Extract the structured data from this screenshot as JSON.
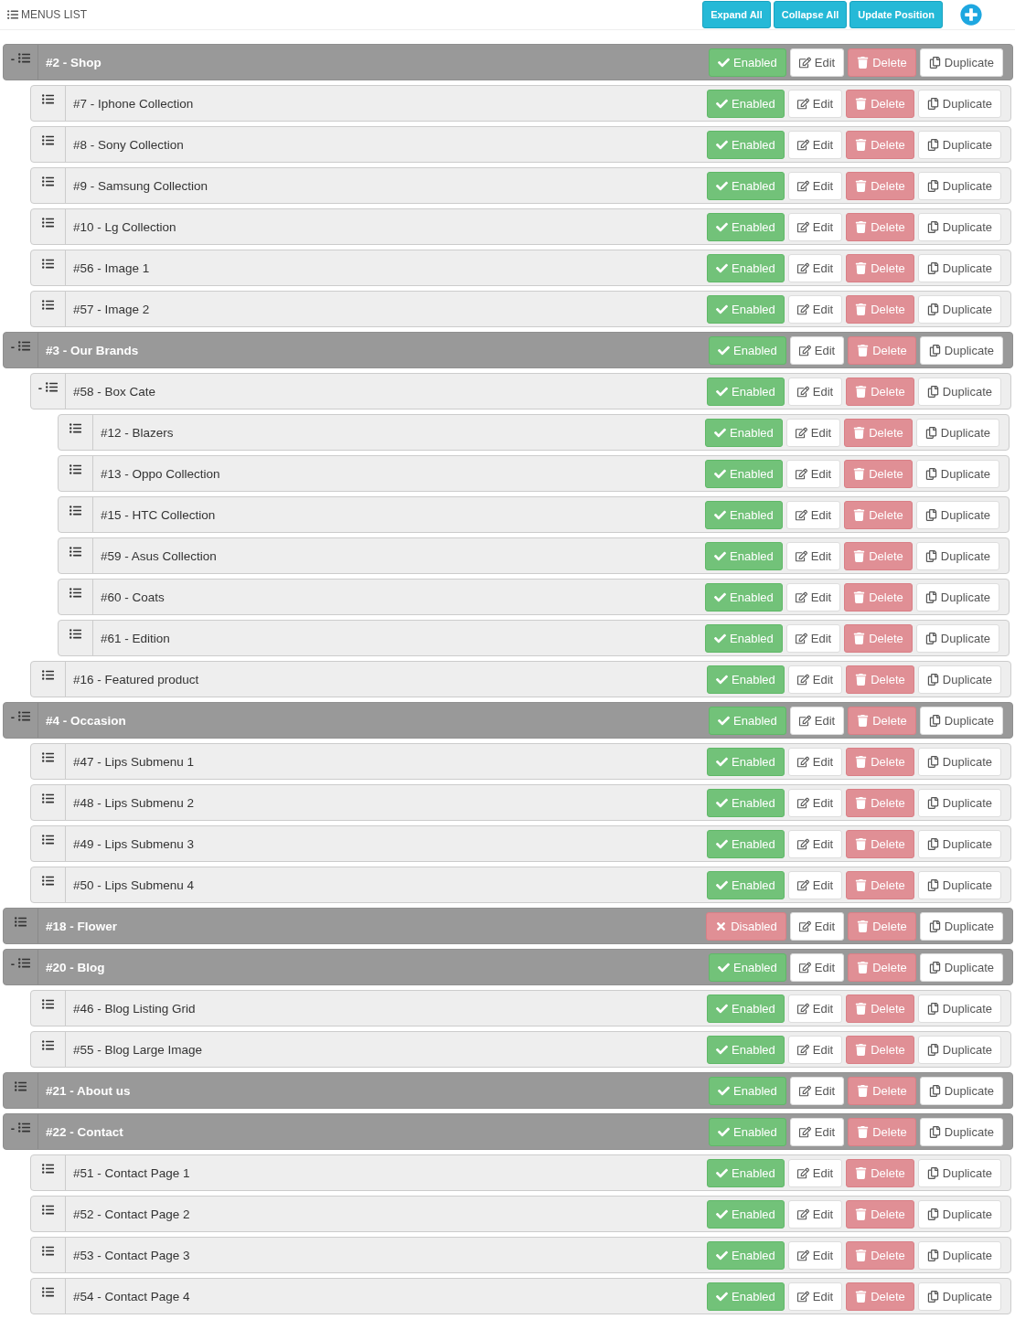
{
  "header": {
    "title": "MENUS LIST",
    "buttons": [
      "Expand All",
      "Collapse All",
      "Update Position"
    ]
  },
  "menus": [
    {
      "label": "#2 - Shop",
      "toggle": "-",
      "status": "Enabled",
      "enabled": true,
      "actions": [
        "Edit",
        "Delete",
        "Duplicate"
      ],
      "children": [
        {
          "label": "#7 - Iphone Collection",
          "status": "Enabled",
          "enabled": true,
          "actions": [
            "Edit",
            "Delete",
            "Duplicate"
          ]
        },
        {
          "label": "#8 - Sony Collection",
          "status": "Enabled",
          "enabled": true,
          "actions": [
            "Edit",
            "Delete",
            "Duplicate"
          ]
        },
        {
          "label": "#9 - Samsung Collection",
          "status": "Enabled",
          "enabled": true,
          "actions": [
            "Edit",
            "Delete",
            "Duplicate"
          ]
        },
        {
          "label": "#10 - Lg Collection",
          "status": "Enabled",
          "enabled": true,
          "actions": [
            "Edit",
            "Delete",
            "Duplicate"
          ]
        },
        {
          "label": "#56 - Image 1",
          "status": "Enabled",
          "enabled": true,
          "actions": [
            "Edit",
            "Delete",
            "Duplicate"
          ]
        },
        {
          "label": "#57 - Image 2",
          "status": "Enabled",
          "enabled": true,
          "actions": [
            "Edit",
            "Delete",
            "Duplicate"
          ]
        }
      ]
    },
    {
      "label": "#3 - Our Brands",
      "toggle": "-",
      "status": "Enabled",
      "enabled": true,
      "actions": [
        "Edit",
        "Delete",
        "Duplicate"
      ],
      "children": [
        {
          "label": "#58 - Box Cate",
          "toggle": "-",
          "status": "Enabled",
          "enabled": true,
          "actions": [
            "Edit",
            "Delete",
            "Duplicate"
          ],
          "children": [
            {
              "label": "#12 - Blazers",
              "status": "Enabled",
              "enabled": true,
              "actions": [
                "Edit",
                "Delete",
                "Duplicate"
              ]
            },
            {
              "label": "#13 - Oppo Collection",
              "status": "Enabled",
              "enabled": true,
              "actions": [
                "Edit",
                "Delete",
                "Duplicate"
              ]
            },
            {
              "label": "#15 - HTC Collection",
              "status": "Enabled",
              "enabled": true,
              "actions": [
                "Edit",
                "Delete",
                "Duplicate"
              ]
            },
            {
              "label": "#59 - Asus Collection",
              "status": "Enabled",
              "enabled": true,
              "actions": [
                "Edit",
                "Delete",
                "Duplicate"
              ]
            },
            {
              "label": "#60 - Coats",
              "status": "Enabled",
              "enabled": true,
              "actions": [
                "Edit",
                "Delete",
                "Duplicate"
              ]
            },
            {
              "label": "#61 - Edition",
              "status": "Enabled",
              "enabled": true,
              "actions": [
                "Edit",
                "Delete",
                "Duplicate"
              ]
            }
          ]
        },
        {
          "label": "#16 - Featured product",
          "status": "Enabled",
          "enabled": true,
          "actions": [
            "Edit",
            "Delete",
            "Duplicate"
          ]
        }
      ]
    },
    {
      "label": "#4 - Occasion",
      "toggle": "-",
      "status": "Enabled",
      "enabled": true,
      "actions": [
        "Edit",
        "Delete",
        "Duplicate"
      ],
      "children": [
        {
          "label": "#47 - Lips Submenu 1",
          "status": "Enabled",
          "enabled": true,
          "actions": [
            "Edit",
            "Delete",
            "Duplicate"
          ]
        },
        {
          "label": "#48 - Lips Submenu 2",
          "status": "Enabled",
          "enabled": true,
          "actions": [
            "Edit",
            "Delete",
            "Duplicate"
          ]
        },
        {
          "label": "#49 - Lips Submenu 3",
          "status": "Enabled",
          "enabled": true,
          "actions": [
            "Edit",
            "Delete",
            "Duplicate"
          ]
        },
        {
          "label": "#50 - Lips Submenu 4",
          "status": "Enabled",
          "enabled": true,
          "actions": [
            "Edit",
            "Delete",
            "Duplicate"
          ]
        }
      ]
    },
    {
      "label": "#18 - Flower",
      "status": "Disabled",
      "enabled": false,
      "actions": [
        "Edit",
        "Delete",
        "Duplicate"
      ]
    },
    {
      "label": "#20 - Blog",
      "toggle": "-",
      "status": "Enabled",
      "enabled": true,
      "actions": [
        "Edit",
        "Delete",
        "Duplicate"
      ],
      "children": [
        {
          "label": "#46 - Blog Listing Grid",
          "status": "Enabled",
          "enabled": true,
          "actions": [
            "Edit",
            "Delete",
            "Duplicate"
          ]
        },
        {
          "label": "#55 - Blog Large Image",
          "status": "Enabled",
          "enabled": true,
          "actions": [
            "Edit",
            "Delete",
            "Duplicate"
          ]
        }
      ]
    },
    {
      "label": "#21 - About us",
      "status": "Enabled",
      "enabled": true,
      "actions": [
        "Edit",
        "Delete",
        "Duplicate"
      ]
    },
    {
      "label": "#22 - Contact",
      "toggle": "-",
      "status": "Enabled",
      "enabled": true,
      "actions": [
        "Edit",
        "Delete",
        "Duplicate"
      ],
      "children": [
        {
          "label": "#51 - Contact Page 1",
          "status": "Enabled",
          "enabled": true,
          "actions": [
            "Edit",
            "Delete",
            "Duplicate"
          ]
        },
        {
          "label": "#52 - Contact Page 2",
          "status": "Enabled",
          "enabled": true,
          "actions": [
            "Edit",
            "Delete",
            "Duplicate"
          ]
        },
        {
          "label": "#53 - Contact Page 3",
          "status": "Enabled",
          "enabled": true,
          "actions": [
            "Edit",
            "Delete",
            "Duplicate"
          ]
        },
        {
          "label": "#54 - Contact Page 4",
          "status": "Enabled",
          "enabled": true,
          "actions": [
            "Edit",
            "Delete",
            "Duplicate"
          ]
        }
      ]
    }
  ]
}
